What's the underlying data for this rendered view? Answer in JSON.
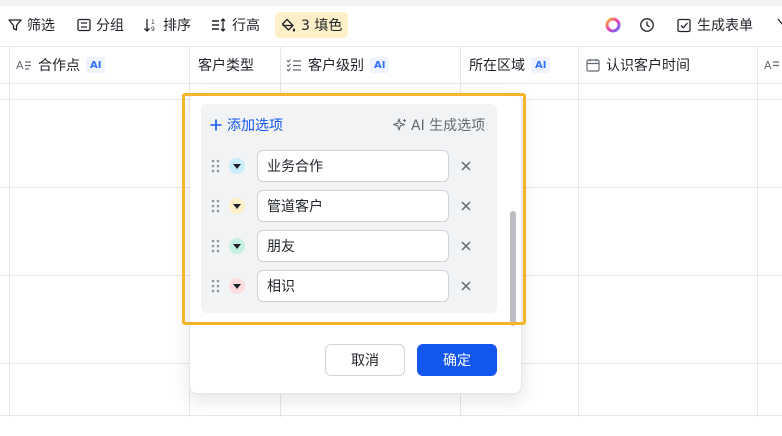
{
  "toolbar": {
    "filter": "筛选",
    "group": "分组",
    "sort": "排序",
    "row_height": "行高",
    "fill": "3 填色",
    "generate_form": "生成表单"
  },
  "columns": [
    {
      "label": "合作点",
      "ai": "AI"
    },
    {
      "label": "客户类型"
    },
    {
      "label": "客户级别",
      "ai": "AI"
    },
    {
      "label": "所在区域",
      "ai": "AI"
    },
    {
      "label": "认识客户时间"
    }
  ],
  "popup": {
    "add_option": "添加选项",
    "ai_generate": "AI 生成选项",
    "options": [
      {
        "value": "业务合作",
        "bg": "#c9eefa",
        "tri": "#1f2329"
      },
      {
        "value": "管道客户",
        "bg": "#fdefc7",
        "tri": "#1f2329"
      },
      {
        "value": "朋友",
        "bg": "#c5f1e4",
        "tri": "#1f2329"
      },
      {
        "value": "相识",
        "bg": "#fcdcdc",
        "tri": "#1f2329"
      }
    ],
    "cancel": "取消",
    "confirm": "确定"
  },
  "colors": {
    "accent": "#1456f0",
    "highlight": "#f7b529",
    "fill_button_bg": "#fdefc7"
  }
}
